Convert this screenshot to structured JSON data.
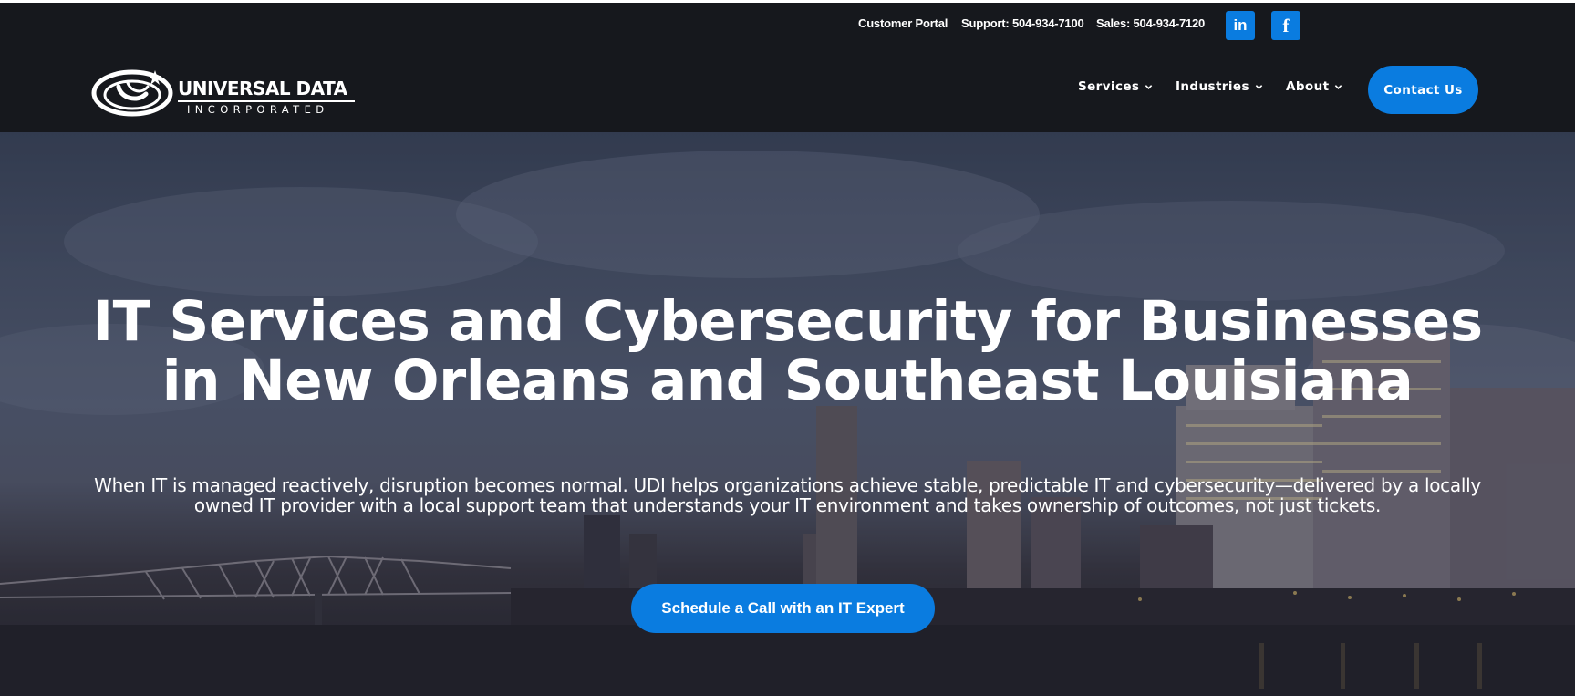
{
  "topbar": {
    "customer_portal": "Customer Portal",
    "support": "Support: 504-934-7100",
    "sales": "Sales: 504-934-7120",
    "linkedin_glyph": "in",
    "facebook_glyph": "f"
  },
  "logo": {
    "name": "UNIVERSAL DATA",
    "subtitle": "INCORPORATED"
  },
  "nav": {
    "items": [
      {
        "label": "Services",
        "icon": "chevron-down-icon"
      },
      {
        "label": "Industries",
        "icon": "chevron-down-icon"
      },
      {
        "label": "About",
        "icon": "chevron-down-icon"
      }
    ],
    "contact_label": "Contact Us"
  },
  "hero": {
    "title": "IT Services and Cybersecurity for Businesses in New Orleans and Southeast Louisiana",
    "subtitle": "When IT is managed reactively, disruption becomes normal. UDI helps organizations achieve stable, predictable IT and cybersecurity—delivered by a locally owned IT provider with a local support team that understands your IT environment and takes ownership of outcomes, not just tickets.",
    "cta_label": "Schedule a Call with an IT Expert"
  },
  "colors": {
    "header_bg": "#16181d",
    "accent": "#0a7ce0",
    "text": "#ffffff"
  }
}
